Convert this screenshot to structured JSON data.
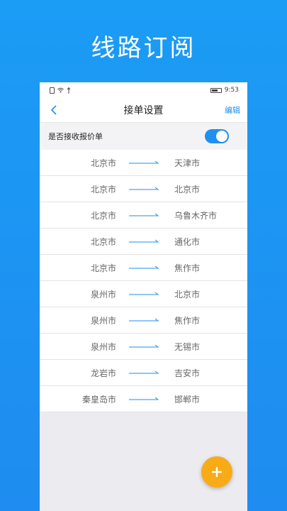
{
  "hero": {
    "title": "线路订阅"
  },
  "status_bar": {
    "time": "9:53"
  },
  "nav": {
    "title": "接单设置",
    "edit_label": "编辑"
  },
  "settings": {
    "receive_quote_label": "是否接收报价单",
    "receive_quote_enabled": true
  },
  "routes": [
    {
      "from": "北京市",
      "to": "天津市"
    },
    {
      "from": "北京市",
      "to": "北京市"
    },
    {
      "from": "北京市",
      "to": "乌鲁木齐市"
    },
    {
      "from": "北京市",
      "to": "通化市"
    },
    {
      "from": "北京市",
      "to": "焦作市"
    },
    {
      "from": "泉州市",
      "to": "北京市"
    },
    {
      "from": "泉州市",
      "to": "焦作市"
    },
    {
      "from": "泉州市",
      "to": "无锡市"
    },
    {
      "from": "龙岩市",
      "to": "吉安市"
    },
    {
      "from": "秦皇岛市",
      "to": "邯郸市"
    }
  ],
  "icons": {
    "back": "chevron-left-icon",
    "arrow": "arrow-right-icon",
    "add": "plus-icon"
  },
  "colors": {
    "accent": "#1f8ff0",
    "fab": "#f8ab16",
    "background": "#1b9cf5"
  }
}
